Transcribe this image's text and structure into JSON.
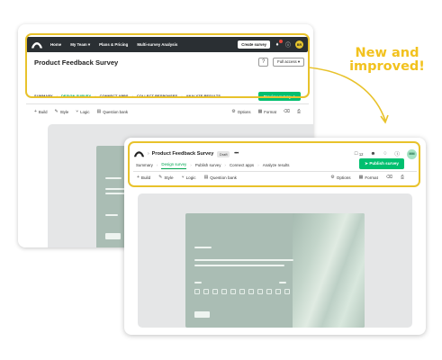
{
  "callout": {
    "line1": "New and",
    "line2": "improved!"
  },
  "old_ui": {
    "nav": {
      "items": [
        "Home",
        "My Team ▾",
        "Plans & Pricing",
        "Multi-survey Analysis"
      ],
      "create_label": "Create survey",
      "avatar": "BR"
    },
    "title": "Product Feedback Survey",
    "help": "?",
    "access_label": "Full access ▾",
    "steps": [
      {
        "label": "SUMMARY",
        "active": false
      },
      {
        "label": "DESIGN SURVEY",
        "active": true
      },
      {
        "label": "CONNECT APPS",
        "active": false
      },
      {
        "label": "COLLECT RESPONSES",
        "active": false
      },
      {
        "label": "ANALYZE RESULTS",
        "active": false
      }
    ],
    "preview_label": "Preview survey",
    "tools_left": [
      {
        "icon": "plus-icon",
        "glyph": "+",
        "label": "Build"
      },
      {
        "icon": "brush-icon",
        "glyph": "✎",
        "label": "Style"
      },
      {
        "icon": "logic-icon",
        "glyph": "⑂",
        "label": "Logic"
      },
      {
        "icon": "bank-icon",
        "glyph": "▤",
        "label": "Question bank"
      }
    ],
    "tools_right": [
      {
        "icon": "gear-icon",
        "glyph": "⚙",
        "label": "Options"
      },
      {
        "icon": "format-icon",
        "glyph": "▦",
        "label": "Format"
      },
      {
        "icon": "trash-icon",
        "glyph": "🗑",
        "label": ""
      },
      {
        "icon": "print-icon",
        "glyph": "⎙",
        "label": ""
      }
    ]
  },
  "new_ui": {
    "title": "Product Feedback Survey",
    "draft": "Draft",
    "more": "•••",
    "comment_count": "12",
    "avatar": "MM",
    "steps": [
      {
        "label": "Summary",
        "active": false
      },
      {
        "label": "Design survey",
        "active": true
      },
      {
        "label": "Publish survey",
        "active": false
      },
      {
        "label": "Connect apps",
        "active": false
      },
      {
        "label": "Analyze results",
        "active": false
      }
    ],
    "publish_label": "Publish survey",
    "tools_left": [
      {
        "icon": "plus-icon",
        "glyph": "+",
        "label": "Build"
      },
      {
        "icon": "brush-icon",
        "glyph": "✎",
        "label": "Style"
      },
      {
        "icon": "logic-icon",
        "glyph": "⑂",
        "label": "Logic"
      },
      {
        "icon": "bank-icon",
        "glyph": "▤",
        "label": "Question bank"
      }
    ],
    "tools_right": [
      {
        "icon": "gear-icon",
        "glyph": "⚙",
        "label": "Options"
      },
      {
        "icon": "format-icon",
        "glyph": "▦",
        "label": "Format"
      },
      {
        "icon": "trash-icon",
        "glyph": "🗑",
        "label": ""
      },
      {
        "icon": "print-icon",
        "glyph": "⎙",
        "label": ""
      }
    ]
  },
  "colors": {
    "accent_green": "#00bf6f",
    "highlight_yellow": "#e8c22b",
    "nav_dark": "#2a2f33"
  }
}
